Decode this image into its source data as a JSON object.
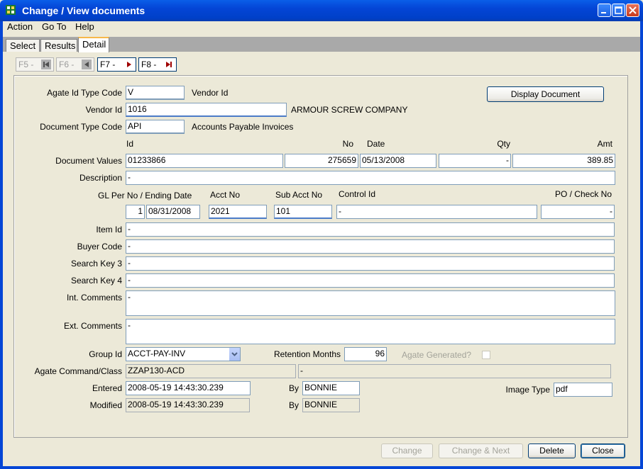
{
  "window": {
    "title": "Change / View documents"
  },
  "menu": {
    "items": [
      "Action",
      "Go To",
      "Help"
    ]
  },
  "tabs": [
    "Select",
    "Results",
    "Detail"
  ],
  "nav": {
    "f5": "F5 -",
    "f6": "F6 -",
    "f7": "F7 -",
    "f8": "F8 -"
  },
  "form": {
    "agate_id_type_code": {
      "label": "Agate Id Type Code",
      "value": "V",
      "desc": "Vendor Id"
    },
    "vendor_id": {
      "label": "Vendor Id",
      "value": "1016",
      "desc": "ARMOUR SCREW COMPANY"
    },
    "document_type_code": {
      "label": "Document Type Code",
      "value": "API",
      "desc": "Accounts Payable Invoices"
    },
    "display_document": "Display Document",
    "doc_values": {
      "label": "Document Values",
      "headers": {
        "id": "Id",
        "no": "No",
        "date": "Date",
        "qty": "Qty",
        "amt": "Amt"
      },
      "id": "01233866",
      "no": "275659",
      "date": "05/13/2008",
      "qty": "-",
      "amt": "389.85"
    },
    "description": {
      "label": "Description",
      "value": "-"
    },
    "gl": {
      "label_gl": "GL Per No / Ending Date",
      "label_acct": "Acct No",
      "label_sub": "Sub Acct No",
      "label_control": "Control Id",
      "label_po": "PO / Check No",
      "per_no": "1",
      "ending_date": "08/31/2008",
      "acct_no": "2021",
      "sub_acct_no": "101",
      "control_id": "-",
      "po_check_no": "-"
    },
    "item_id": {
      "label": "Item Id",
      "value": "-"
    },
    "buyer_code": {
      "label": "Buyer Code",
      "value": "-"
    },
    "search_key_3": {
      "label": "Search Key 3",
      "value": "-"
    },
    "search_key_4": {
      "label": "Search Key 4",
      "value": "-"
    },
    "int_comments": {
      "label": "Int. Comments",
      "value": "-"
    },
    "ext_comments": {
      "label": "Ext. Comments",
      "value": "-"
    },
    "group_id": {
      "label": "Group Id",
      "value": "ACCT-PAY-INV"
    },
    "retention_months": {
      "label": "Retention Months",
      "value": "96"
    },
    "agate_generated": {
      "label": "Agate Generated?",
      "checked": false
    },
    "agate_command": {
      "label": "Agate Command/Class",
      "command": "ZZAP130-ACD",
      "class": "-"
    },
    "entered": {
      "label": "Entered",
      "value": "2008-05-19 14:43:30.239",
      "by_label": "By",
      "by": "BONNIE"
    },
    "modified": {
      "label": "Modified",
      "value": "2008-05-19 14:43:30.239",
      "by_label": "By",
      "by": "BONNIE"
    },
    "image_type": {
      "label": "Image Type",
      "value": "pdf"
    }
  },
  "buttons": {
    "change": "Change",
    "change_next": "Change & Next",
    "delete": "Delete",
    "close": "Close"
  },
  "colors": {
    "titlebar": "#0A5EE8",
    "tab_highlight": "#F7B84B",
    "window_bg": "#ECE9D8"
  }
}
